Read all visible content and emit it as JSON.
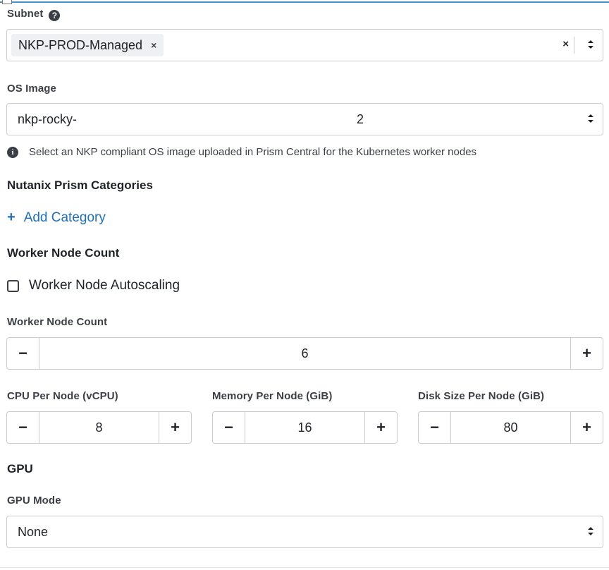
{
  "subnet": {
    "label": "Subnet",
    "chip_value": "NKP-PROD-Managed",
    "chip_remove": "×",
    "clear": "×"
  },
  "os_image": {
    "label": "OS Image",
    "value_start": "nkp-rocky-",
    "value_end": "2",
    "help_text": "Select an NKP compliant OS image uploaded in Prism Central for the Kubernetes worker nodes"
  },
  "categories": {
    "title": "Nutanix Prism Categories",
    "add_label": "Add Category",
    "add_icon": "+"
  },
  "worker_section": {
    "title": "Worker Node Count",
    "autoscaling_label": "Worker Node Autoscaling",
    "autoscaling_checked": false
  },
  "worker_count": {
    "label": "Worker Node Count",
    "value": "6"
  },
  "cpu": {
    "label": "CPU Per Node (vCPU)",
    "value": "8"
  },
  "memory": {
    "label": "Memory Per Node (GiB)",
    "value": "16"
  },
  "disk": {
    "label": "Disk Size Per Node (GiB)",
    "value": "80"
  },
  "gpu": {
    "title": "GPU",
    "mode_label": "GPU Mode",
    "mode_value": "None"
  },
  "stepper_glyphs": {
    "minus": "−",
    "plus": "+"
  },
  "colors": {
    "accent": "#1f6fb8",
    "text": "#1f2328",
    "border": "#c9cdd2"
  }
}
